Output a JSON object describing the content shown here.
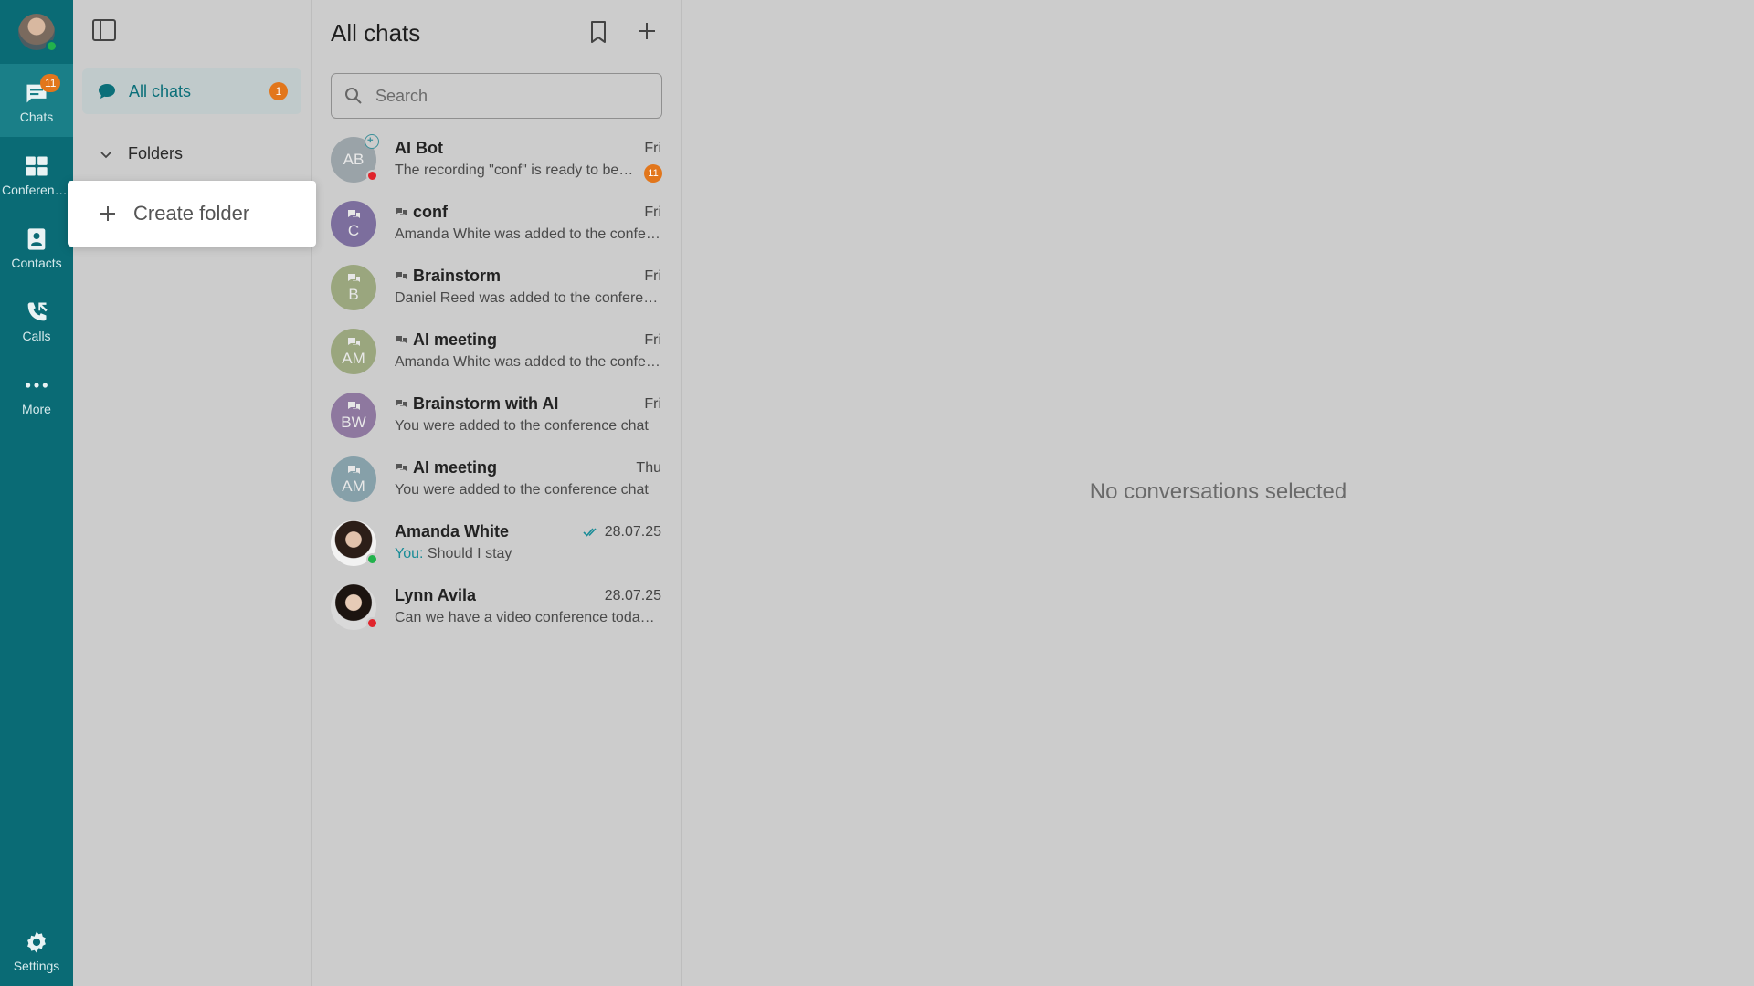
{
  "rail": {
    "items": [
      {
        "label": "Chats",
        "badge": "11",
        "icon": "chat-icon"
      },
      {
        "label": "Conferences",
        "icon": "conference-icon"
      },
      {
        "label": "Contacts",
        "icon": "contacts-icon"
      },
      {
        "label": "Calls",
        "icon": "calls-icon"
      },
      {
        "label": "More",
        "icon": "more-icon"
      }
    ],
    "settings_label": "Settings"
  },
  "folders": {
    "all_chats_label": "All chats",
    "all_chats_badge": "1",
    "folders_title": "Folders",
    "create_folder_label": "Create folder"
  },
  "chatlist": {
    "title": "All chats",
    "search": {
      "placeholder": "Search",
      "value": ""
    },
    "chats": [
      {
        "name": "AI Bot",
        "initials": "AB",
        "date": "Fri",
        "preview": "The recording \"conf\" is ready to be t...",
        "unread": "11",
        "color": "#9aa3a8"
      },
      {
        "name": "conf",
        "initials": "C",
        "date": "Fri",
        "preview": "Amanda White was added to the confer...",
        "color": "#7c6e9d"
      },
      {
        "name": "Brainstorm",
        "initials": "B",
        "date": "Fri",
        "preview": "Daniel Reed was added to the conferen...",
        "color": "#9aa67e"
      },
      {
        "name": "AI meeting",
        "initials": "AM",
        "date": "Fri",
        "preview": "Amanda White was added to the confer...",
        "color": "#9aa67e"
      },
      {
        "name": "Brainstorm with AI",
        "initials": "BW",
        "date": "Fri",
        "preview": "You were added to the conference chat",
        "color": "#8e789f"
      },
      {
        "name": "AI meeting",
        "initials": "AM",
        "date": "Thu",
        "preview": "You were added to the conference chat",
        "color": "#86a0a9"
      },
      {
        "name": "Amanda White",
        "date": "28.07.25",
        "you_prefix": "You:",
        "preview": "Should I stay"
      },
      {
        "name": "Lynn Avila",
        "date": "28.07.25",
        "preview": "Can we have a video conference today ..."
      }
    ]
  },
  "main": {
    "empty_state": "No conversations selected"
  },
  "colors": {
    "rail": "#0a6b75",
    "accent": "#0b6f79",
    "badge": "#e2761b",
    "background": "#cccccc"
  }
}
